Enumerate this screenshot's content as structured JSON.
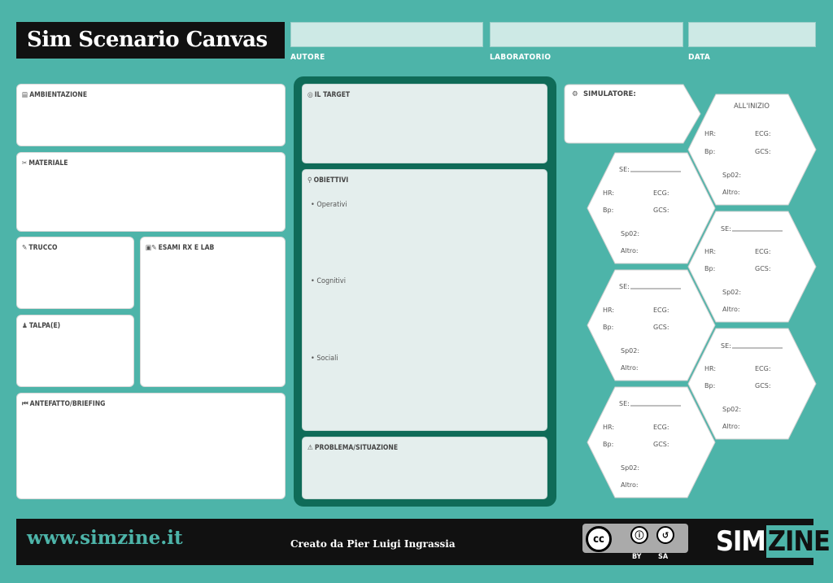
{
  "header": {
    "title": "Sim Scenario Canvas",
    "fields": [
      {
        "label": "AUTORE",
        "value": ""
      },
      {
        "label": "LABORATORIO",
        "value": ""
      },
      {
        "label": "DATA",
        "value": ""
      }
    ]
  },
  "left": {
    "ambientazione": "AMBIENTAZIONE",
    "materiale": "MATERIALE",
    "trucco": "TRUCCO",
    "esami": "ESAMI RX E LAB",
    "talpa": "TALPA(E)",
    "antefatto": "ANTEFATTO/BRIEFING"
  },
  "center": {
    "target": "IL TARGET",
    "obiettivi": "OBIETTIVI",
    "operativi": "• Operativi",
    "cognitivi": "• Cognitivi",
    "sociali": "• Sociali",
    "problema": "PROBLEMA/SITUAZIONE"
  },
  "right": {
    "simulatore": "SIMULATORE:",
    "initial_title": "ALL'INIZIO",
    "se_label": "SE:",
    "hr": "HR:",
    "ecg": "ECG:",
    "bp": "Bp:",
    "gcs": "GCS:",
    "spo2": "Sp02:",
    "altro": "Altro:"
  },
  "footer": {
    "url": "www.simzine.it",
    "creator": "Creato da Pier Luigi Ingrassia",
    "license_by": "BY",
    "license_sa": "SA",
    "brand_sim": "SIM",
    "brand_zine": "ZINE"
  },
  "colors": {
    "background": "#4db4a9",
    "target_frame": "#0f6b58",
    "footer": "#111111"
  }
}
